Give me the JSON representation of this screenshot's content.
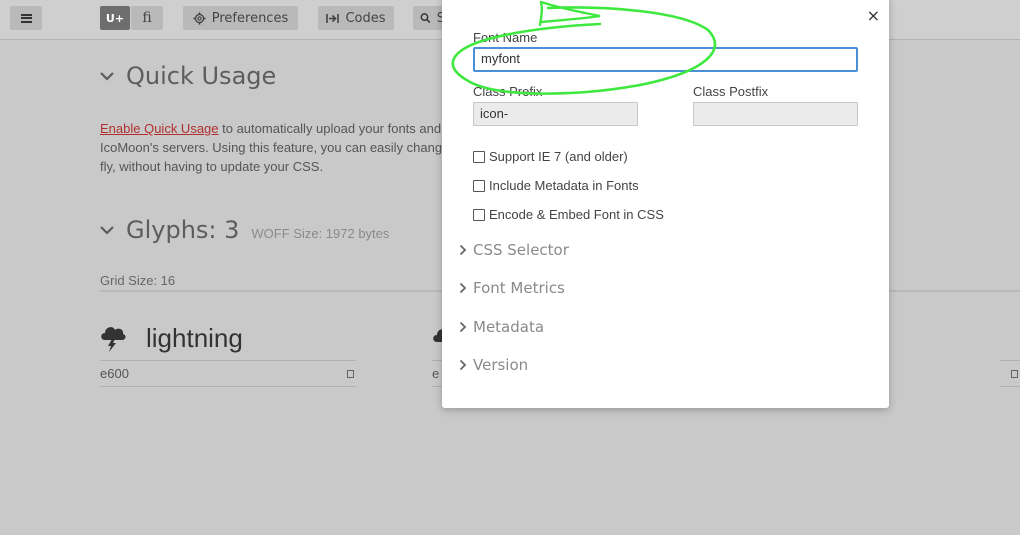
{
  "toolbar": {
    "menu_icon": "hamburger-icon",
    "unicode_toggle_label": "U+",
    "ligature_toggle_label": "fi",
    "preferences_label": "Preferences",
    "preferences_icon": "gear-icon",
    "codes_label": "Codes",
    "codes_icon": "code-arrow-icon",
    "search_icon": "search-icon",
    "search_partial": "S"
  },
  "quick_usage": {
    "heading": "Quick Usage",
    "link_text": "Enable Quick Usage",
    "line1_rest": " to automatically upload your fonts and",
    "line2": "IcoMoon's servers. Using this feature, you can easily change",
    "line3": "fly, without having to update your CSS."
  },
  "glyphs": {
    "heading": "Glyphs: 3",
    "woff_size": "WOFF Size: 1972 bytes",
    "grid_size": "Grid Size: 16",
    "items": [
      {
        "name": "lightning",
        "code": "e600",
        "icon": "lightning-cloud-icon"
      },
      {
        "name": "",
        "code": "e",
        "icon": "cloud-icon"
      }
    ]
  },
  "modal": {
    "close_label": "×",
    "font_name_label": "Font Name",
    "font_name_value": "myfont",
    "class_prefix_label": "Class Prefix",
    "class_prefix_value": "icon-",
    "class_postfix_label": "Class Postfix",
    "class_postfix_value": "",
    "checkboxes": [
      {
        "label": "Support IE 7 (and older)",
        "checked": false
      },
      {
        "label": "Include Metadata in Fonts",
        "checked": false
      },
      {
        "label": "Encode & Embed Font in CSS",
        "checked": false
      }
    ],
    "sections": [
      "CSS Selector",
      "Font Metrics",
      "Metadata",
      "Version"
    ]
  },
  "colors": {
    "annotation_green": "#3ee83e",
    "focus_blue": "#4a90d9",
    "link_red": "#b02f2f",
    "overlay_gray": "#c9c9c9"
  }
}
